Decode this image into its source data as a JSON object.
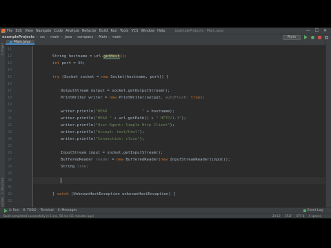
{
  "menubar": {
    "items": [
      "File",
      "Edit",
      "View",
      "Navigate",
      "Code",
      "Analyze",
      "Refactor",
      "Build",
      "Run",
      "Tools",
      "VCS",
      "Window",
      "Help"
    ],
    "window_title": "exampleProjects - Main.java",
    "controls": [
      "—",
      "☐",
      "✕"
    ]
  },
  "navbar": {
    "breadcrumbs": [
      "exampleProjects",
      "src",
      "main",
      "java",
      "company",
      "Main",
      "main"
    ],
    "run_config": "Main"
  },
  "editor_tab": {
    "label": "Main.java"
  },
  "left_strip": {
    "labels": [
      "1: Project",
      "2: Structure",
      "Favorites"
    ]
  },
  "code": {
    "lines": [
      {
        "n": "11"
      },
      {
        "n": "12"
      },
      {
        "n": "13"
      },
      {
        "n": "14"
      },
      {
        "n": "15"
      },
      {
        "n": "16"
      },
      {
        "n": "17"
      },
      {
        "n": "18"
      },
      {
        "n": "19"
      },
      {
        "n": "20"
      },
      {
        "n": "21"
      },
      {
        "n": "22"
      },
      {
        "n": "23"
      },
      {
        "n": "24"
      },
      {
        "n": "25"
      },
      {
        "n": "26"
      },
      {
        "n": "27"
      },
      {
        "n": "28"
      },
      {
        "n": "29"
      },
      {
        "n": "30"
      },
      {
        "n": "31"
      },
      {
        "n": "32"
      },
      {
        "n": "33"
      }
    ],
    "l12_a": "String hostname = url.",
    "l12_b": "getHost",
    "l12_c": "();",
    "l13_a": "int",
    "l13_b": " port = ",
    "l13_c": "80",
    "l13_d": ";",
    "l15_a": "try",
    "l15_b": " (Socket socket = ",
    "l15_c": "new",
    "l15_d": " Socket(hostname, port)) {",
    "l17_a": "OutputStream output = socket.getOutputStream();",
    "l18_a": "PrintWriter writer = ",
    "l18_b": "new",
    "l18_c": " PrintWriter(output, ",
    "l18_d": "autoFlush:",
    "l18_e": " ",
    "l18_f": "true",
    "l18_g": ");",
    "l20_a": "writer.println(",
    "l20_b": "\"HEAD               \"",
    "l20_c": " + hostname);",
    "l21_a": "writer.println(",
    "l21_b": "\"HEAD \"",
    "l21_c": " + url.getPath() + ",
    "l21_d": "\" HTTP/1.1\"",
    "l21_e": ");",
    "l22_a": "writer.println(",
    "l22_b": "\"User-Agent: Simple Http Client\"",
    "l22_c": ");",
    "l23_a": "writer.println(",
    "l23_b": "\"Accept: text/html\"",
    "l23_c": ");",
    "l24_a": "writer.println(",
    "l24_b": "\"Connection: close\"",
    "l24_c": ");",
    "l26_a": "InputStream input = socket.getInputStream();",
    "l27_a": "BufferedReader ",
    "l27_b": "reader",
    "l27_c": " = ",
    "l27_d": "new",
    "l27_e": " BufferedReader(",
    "l27_f": "new",
    "l27_g": " InputStreamReader(input));",
    "l28_a": "String ",
    "l28_b": "line;",
    "l31_a": "} ",
    "l31_b": "catch",
    "l31_c": " (UnknownHostException unknownHostException) {"
  },
  "bottom_tools": {
    "items": [
      "4: Run",
      "6: TODO",
      "Terminal",
      "0: Messages"
    ],
    "right": "Event Log"
  },
  "status": {
    "message": "Build completed successfully in 1 sec, 58 ms (11 minutes ago)",
    "position": "30:13",
    "line_sep": "CRLF",
    "encoding": "UTF-8",
    "indent": "4 spaces"
  }
}
